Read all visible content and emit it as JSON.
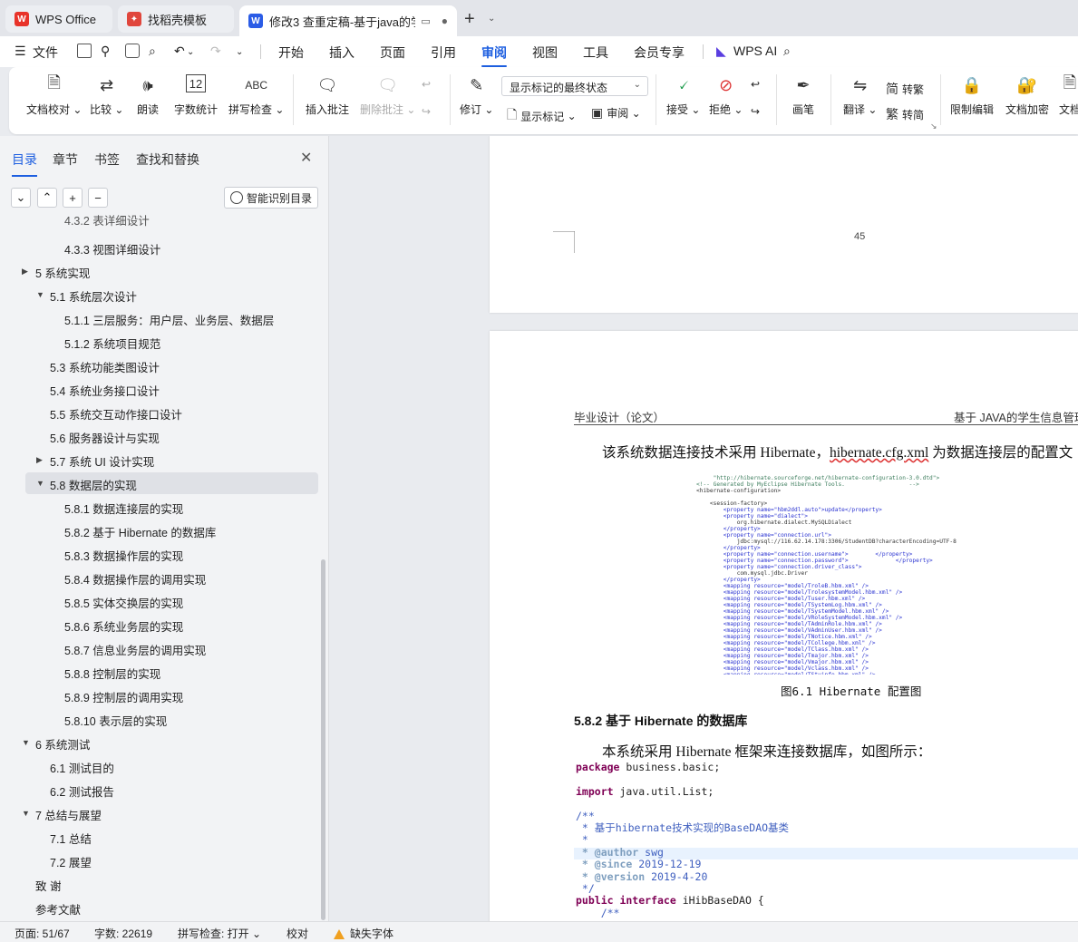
{
  "tabs": [
    {
      "label": "WPS Office",
      "active": false
    },
    {
      "label": "找稻壳模板",
      "active": false
    },
    {
      "label": "修改3 查重定稿-基于java的学",
      "active": true
    }
  ],
  "menu": {
    "file": "文件",
    "items": [
      "开始",
      "插入",
      "页面",
      "引用",
      "审阅",
      "视图",
      "工具",
      "会员专享"
    ],
    "active": "审阅",
    "ai": "WPS AI"
  },
  "ribbon": {
    "proofread": "文档校对",
    "compare": "比较",
    "read_aloud": "朗读",
    "word_count": "字数统计",
    "spell_check": "拼写检查",
    "insert_comment": "插入批注",
    "delete_comment": "删除批注",
    "track_changes": "修订",
    "markup_dropdown": "显示标记的最终状态",
    "show_markup": "显示标记",
    "review": "审阅",
    "accept": "接受",
    "reject": "拒绝",
    "pen": "画笔",
    "translate": "翻译",
    "to_traditional": "转繁",
    "to_simplified": "转简",
    "restrict_edit": "限制编辑",
    "encrypt": "文档加密",
    "doc_more": "文档"
  },
  "panel": {
    "tabs": [
      "目录",
      "章节",
      "书签",
      "查找和替换"
    ],
    "active_tab": "目录",
    "smart_button": "智能识别目录",
    "toc": [
      {
        "label": "4.3.2 表详细设计",
        "level": 3,
        "expand": "none"
      },
      {
        "label": "4.3.3 视图详细设计",
        "level": 3,
        "expand": "none"
      },
      {
        "label": "5 系统实现",
        "level": 1,
        "expand": "collapsed"
      },
      {
        "label": "5.1 系统层次设计",
        "level": 2,
        "expand": "expanded"
      },
      {
        "label": "5.1.1 三层服务：用户层、业务层、数据层",
        "level": 3,
        "expand": "none"
      },
      {
        "label": "5.1.2 系统项目规范",
        "level": 3,
        "expand": "none"
      },
      {
        "label": "5.3 系统功能类图设计",
        "level": 2,
        "expand": "none"
      },
      {
        "label": "5.4 系统业务接口设计",
        "level": 2,
        "expand": "none"
      },
      {
        "label": "5.5 系统交互动作接口设计",
        "level": 2,
        "expand": "none"
      },
      {
        "label": "5.6 服务器设计与实现",
        "level": 2,
        "expand": "none"
      },
      {
        "label": "5.7 系统 UI 设计实现",
        "level": 2,
        "expand": "collapsed"
      },
      {
        "label": "5.8 数据层的实现",
        "level": 2,
        "expand": "expanded",
        "selected": true
      },
      {
        "label": "5.8.1 数据连接层的实现",
        "level": 3,
        "expand": "none"
      },
      {
        "label": "5.8.2 基于 Hibernate 的数据库",
        "level": 3,
        "expand": "none"
      },
      {
        "label": "5.8.3 数据操作层的实现",
        "level": 3,
        "expand": "none"
      },
      {
        "label": "5.8.4 数据操作层的调用实现",
        "level": 3,
        "expand": "none"
      },
      {
        "label": "5.8.5 实体交换层的实现",
        "level": 3,
        "expand": "none"
      },
      {
        "label": "5.8.6 系统业务层的实现",
        "level": 3,
        "expand": "none"
      },
      {
        "label": "5.8.7 信息业务层的调用实现",
        "level": 3,
        "expand": "none"
      },
      {
        "label": "5.8.8 控制层的实现",
        "level": 3,
        "expand": "none"
      },
      {
        "label": "5.8.9 控制层的调用实现",
        "level": 3,
        "expand": "none"
      },
      {
        "label": "5.8.10 表示层的实现",
        "level": 3,
        "expand": "none"
      },
      {
        "label": "6 系统测试",
        "level": 1,
        "expand": "expanded"
      },
      {
        "label": "6.1 测试目的",
        "level": 2,
        "expand": "none"
      },
      {
        "label": "6.2 测试报告",
        "level": 2,
        "expand": "none"
      },
      {
        "label": "7 总结与展望",
        "level": 1,
        "expand": "expanded"
      },
      {
        "label": "7.1  总结",
        "level": 2,
        "expand": "none"
      },
      {
        "label": "7.2  展望",
        "level": 2,
        "expand": "none"
      },
      {
        "label": "致    谢",
        "level": 1,
        "expand": "none"
      },
      {
        "label": "参考文献",
        "level": 1,
        "expand": "none"
      }
    ]
  },
  "document": {
    "prev_page_number": "45",
    "header_left": "毕业设计（论文）",
    "header_right": "基于 JAVA的学生信息管理",
    "para1_a": "该系统数据连接技术采用 Hibernate，",
    "para1_wavy": "hibernate.cfg.xml",
    "para1_b": " 为数据连接层的配置文",
    "figure_lines": [
      "     \"http://hibernate.sourceforge.net/hibernate-configuration-3.0.dtd\">",
      "<!-- Generated by MyEclipse Hibernate Tools.                   -->",
      "<hibernate-configuration>",
      "",
      "    <session-factory>",
      "        <property name=\"hbm2ddl.auto\">update</property>",
      "        <property name=\"dialect\">",
      "            org.hibernate.dialect.MySQLDialect",
      "        </property>",
      "        <property name=\"connection.url\">",
      "            jdbc:mysql://116.62.14.178:3306/StudentDB?characterEncoding=UTF-8",
      "        </property>",
      "        <property name=\"connection.username\">        </property>",
      "        <property name=\"connection.password\">              </property>",
      "        <property name=\"connection.driver_class\">",
      "            com.mysql.jdbc.Driver",
      "        </property>",
      "        <mapping resource=\"model/TroleB.hbm.xml\" />",
      "        <mapping resource=\"model/TrolesystemModel.hbm.xml\" />",
      "        <mapping resource=\"model/Tuser.hbm.xml\" />",
      "        <mapping resource=\"model/TSystemLog.hbm.xml\" />",
      "        <mapping resource=\"model/TSystemModel.hbm.xml\" />",
      "        <mapping resource=\"model/VRoleSystemModel.hbm.xml\" />",
      "        <mapping resource=\"model/TAdminRole.hbm.xml\" />",
      "        <mapping resource=\"model/VAdminUser.hbm.xml\" />",
      "        <mapping resource=\"model/TNotice.hbm.xml\" />",
      "        <mapping resource=\"model/TCollege.hbm.xml\" />",
      "        <mapping resource=\"model/TClass.hbm.xml\" />",
      "        <mapping resource=\"model/Tmajor.hbm.xml\" />",
      "        <mapping resource=\"model/Vmajor.hbm.xml\" />",
      "        <mapping resource=\"model/Vclass.hbm.xml\" />",
      "        <mapping resource=\"model/TStuinfo.hbm.xml\" />"
    ],
    "caption": "图6.1 Hibernate 配置图",
    "section_heading": "5.8.2 基于 Hibernate 的数据库",
    "para2": "本系统采用 Hibernate 框架来连接数据库，如图所示：",
    "code": {
      "package": "package",
      "package_rest": " business.basic;",
      "import": "import",
      "import_rest": " java.util.List;",
      "jd_open": "/**",
      "jd_desc": " * 基于hibernate技术实现的BaseDAO基类",
      "jd_star": " *",
      "jd_author_tag": " * @author",
      "jd_author": " swg",
      "jd_since_tag": " * @since",
      "jd_since": " 2019-12-19",
      "jd_version_tag": " * @version",
      "jd_version": " 2019-4-20",
      "jd_close": " */",
      "decl_kw": "public interface",
      "decl_rest": " iHibBaseDAO {",
      "inner_open": "    /**"
    }
  },
  "status": {
    "page": "页面: 51/67",
    "word_count": "字数: 22619",
    "spell_check": "拼写检查: 打开",
    "proofread": "校对",
    "missing_font": "缺失字体"
  },
  "colors": {
    "accent": "#1e5fe0",
    "wps_red": "#e8332a",
    "template_red": "#e0463c",
    "writer_blue": "#2b5ce6",
    "warning": "#f0a020"
  }
}
